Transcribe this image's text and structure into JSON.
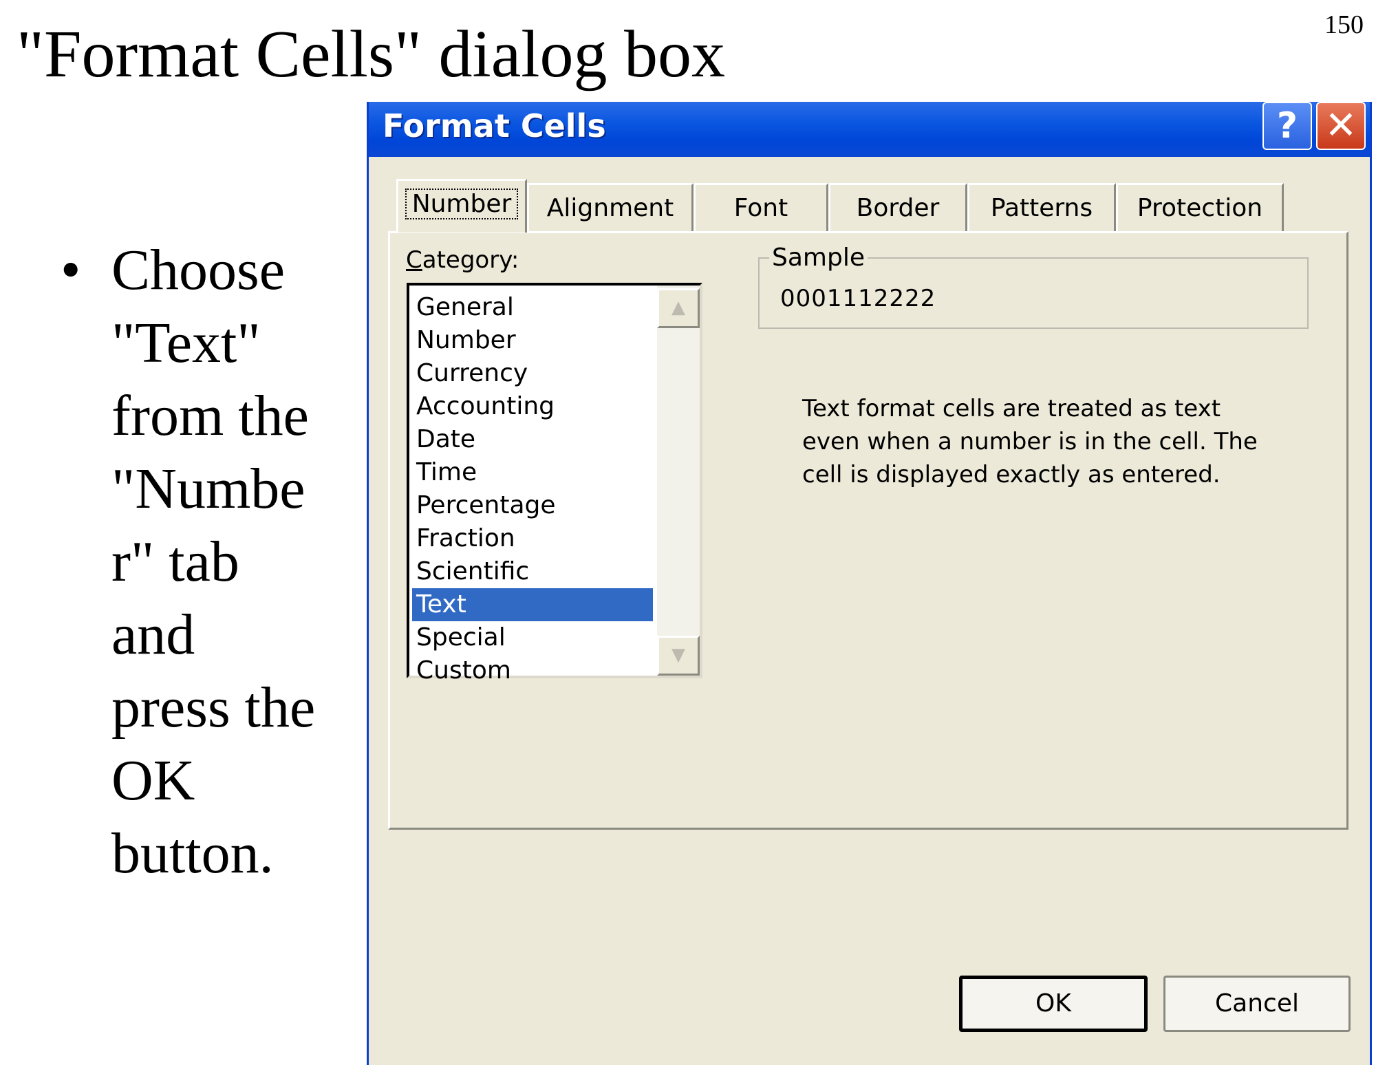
{
  "slide": {
    "title": "\"Format Cells\" dialog box",
    "page_number": "150",
    "bullet_symbol": "•",
    "bullet_lines": [
      "Choose",
      "\"Text\"",
      "from the",
      "\"Numbe",
      "r\" tab",
      "and",
      "press the",
      "OK",
      "button."
    ]
  },
  "dialog": {
    "title": "Format Cells",
    "help_glyph": "?",
    "close_glyph": "✕",
    "tabs": [
      {
        "label": "Number",
        "active": true
      },
      {
        "label": "Alignment",
        "active": false
      },
      {
        "label": "Font",
        "active": false
      },
      {
        "label": "Border",
        "active": false
      },
      {
        "label": "Patterns",
        "active": false
      },
      {
        "label": "Protection",
        "active": false
      }
    ],
    "category": {
      "mnemonic": "C",
      "label_rest": "ategory:",
      "items": [
        "General",
        "Number",
        "Currency",
        "Accounting",
        "Date",
        "Time",
        "Percentage",
        "Fraction",
        "Scientific",
        "Text",
        "Special",
        "Custom"
      ],
      "selected": "Text",
      "scroll_up_glyph": "▲",
      "scroll_down_glyph": "▼"
    },
    "sample": {
      "label": "Sample",
      "value": "0001112222"
    },
    "description": "Text format cells are treated as text even when a number is in the cell.  The cell is displayed exactly as entered.",
    "buttons": {
      "ok": "OK",
      "cancel": "Cancel"
    },
    "colors": {
      "titlebar": "#0a56e0",
      "dialog_bg": "#ece9d8",
      "selection": "#316ac5"
    }
  }
}
